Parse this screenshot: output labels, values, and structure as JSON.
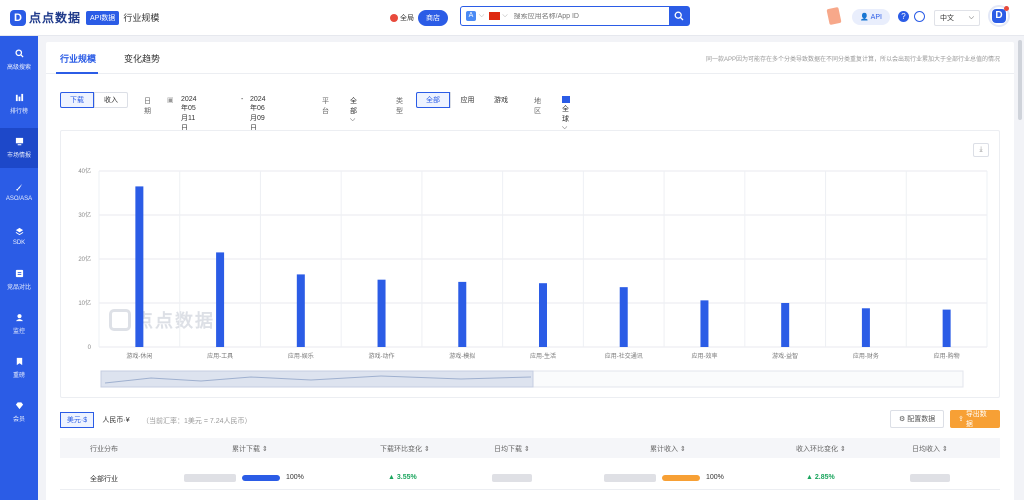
{
  "header": {
    "logo_text": "点点数据",
    "api_badge": "API数据",
    "page_name": "行业规模",
    "scope_all": "全局",
    "scope_store": "商店",
    "search_placeholder": "搜索应用名称/App ID",
    "api_label": "API",
    "language": "中文",
    "avatar_letter": "D"
  },
  "sidebar": {
    "items": [
      {
        "label": "高级搜索",
        "icon": "search-icon"
      },
      {
        "label": "排行榜",
        "icon": "bar-chart-icon"
      },
      {
        "label": "市场情报",
        "icon": "monitor-icon"
      },
      {
        "label": "ASO/ASA",
        "icon": "rocket-icon"
      },
      {
        "label": "SDK",
        "icon": "layers-icon"
      },
      {
        "label": "竞品对比",
        "icon": "compare-icon"
      },
      {
        "label": "监控",
        "icon": "user-monitor-icon"
      },
      {
        "label": "重磅",
        "icon": "bookmark-icon"
      },
      {
        "label": "会员",
        "icon": "diamond-icon"
      }
    ],
    "active_index": 2
  },
  "tabs": {
    "items": [
      "行业规模",
      "变化趋势"
    ],
    "active_index": 0,
    "note": "同一款APP因为可能存在多个分类导致数据在不同分类重复计算，所以会出现行业累加大于全部行业总值的情况"
  },
  "filters": {
    "download_label": "下载",
    "revenue_label": "收入",
    "date_label": "日期",
    "date_start": "2024年05月11日",
    "date_sep": "-",
    "date_end": "2024年06月09日",
    "platform_label": "平台",
    "platform_value": "全部",
    "type_label": "类型",
    "type_options": [
      "全部",
      "应用",
      "游戏"
    ],
    "region_label": "地区",
    "region_value": "全球"
  },
  "chart_data": {
    "type": "bar",
    "categories": [
      "游戏-休闲",
      "应用-工具",
      "应用-娱乐",
      "游戏-动作",
      "游戏-模拟",
      "应用-生活",
      "应用-社交通讯",
      "应用-效率",
      "游戏-益智",
      "应用-财务",
      "应用-购物"
    ],
    "values": [
      36.5,
      21.5,
      16.5,
      15.3,
      14.8,
      14.5,
      13.6,
      10.6,
      10.0,
      8.8,
      8.5
    ],
    "yticks": [
      "0",
      "10亿",
      "20亿",
      "30亿",
      "40亿"
    ],
    "ylim": [
      0,
      40
    ],
    "grid": true,
    "bar_color": "#2b5ce6",
    "watermark": "点点数据"
  },
  "currency": {
    "usd": "美元·$",
    "rmb": "人民币·¥",
    "rate_note": "（当前汇率：1美元 = 7.24人民币）",
    "config_label": "配置数据",
    "export_label": "导出数据"
  },
  "table": {
    "headers": [
      "行业分布",
      "累计下载 ⇕",
      "下载环比变化 ⇕",
      "日均下载 ⇕",
      "累计收入 ⇕",
      "收入环比变化 ⇕",
      "日均收入 ⇕"
    ],
    "rows": [
      {
        "industry": "全部行业",
        "download_pct": "100%",
        "download_change": "▲ 3.55%",
        "revenue_pct": "100%",
        "revenue_change": "▲ 2.85%",
        "download_bar_color": "#2b5ce6",
        "revenue_bar_color": "#f7a035"
      }
    ]
  }
}
